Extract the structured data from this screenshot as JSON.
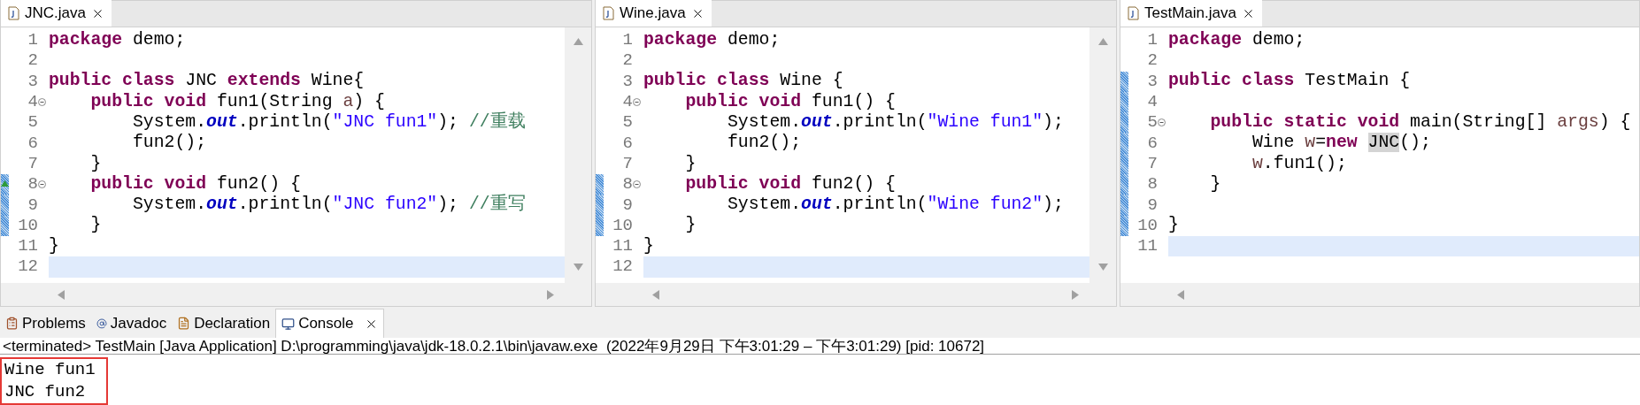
{
  "editors": [
    {
      "tab": {
        "title": "JNC.java",
        "selected": true
      },
      "vertical_scrollbar": true,
      "lines": [
        {
          "number": "1",
          "fold": false,
          "override": false,
          "changed": false,
          "current": false,
          "tokens": [
            {
              "kind": "kw",
              "text": "package"
            },
            {
              "kind": "text",
              "text": " demo;"
            }
          ]
        },
        {
          "number": "2",
          "fold": false,
          "override": false,
          "changed": false,
          "current": false
        },
        {
          "number": "3",
          "fold": false,
          "override": false,
          "changed": false,
          "current": false,
          "tokens": [
            {
              "kind": "kw",
              "text": "public class"
            },
            {
              "kind": "text",
              "text": " JNC "
            },
            {
              "kind": "kw",
              "text": "extends"
            },
            {
              "kind": "text",
              "text": " Wine{"
            }
          ]
        },
        {
          "number": "4",
          "fold": true,
          "override": false,
          "changed": false,
          "current": false,
          "tokens": [
            {
              "kind": "kw",
              "text": "    public void"
            },
            {
              "kind": "text",
              "text": " fun1(String "
            },
            {
              "kind": "var",
              "text": "a"
            },
            {
              "kind": "text",
              "text": ") {"
            }
          ]
        },
        {
          "number": "5",
          "fold": false,
          "override": false,
          "changed": false,
          "current": false,
          "tokens": [
            {
              "kind": "text",
              "text": "        System."
            },
            {
              "kind": "field",
              "text": "out"
            },
            {
              "kind": "text",
              "text": ".println("
            },
            {
              "kind": "str",
              "text": "\"JNC fun1\""
            },
            {
              "kind": "text",
              "text": "); "
            },
            {
              "kind": "comment",
              "text": "//重载"
            }
          ]
        },
        {
          "number": "6",
          "fold": false,
          "override": false,
          "changed": false,
          "current": false,
          "tokens": [
            {
              "kind": "text",
              "text": "        fun2();"
            }
          ]
        },
        {
          "number": "7",
          "fold": false,
          "override": false,
          "changed": false,
          "current": false,
          "tokens": [
            {
              "kind": "text",
              "text": "    }"
            }
          ]
        },
        {
          "number": "8",
          "fold": true,
          "override": true,
          "changed": true,
          "current": false,
          "tokens": [
            {
              "kind": "kw",
              "text": "    public void"
            },
            {
              "kind": "text",
              "text": " fun2() {"
            }
          ]
        },
        {
          "number": "9",
          "fold": false,
          "override": false,
          "changed": true,
          "current": false,
          "tokens": [
            {
              "kind": "text",
              "text": "        System."
            },
            {
              "kind": "field",
              "text": "out"
            },
            {
              "kind": "text",
              "text": ".println("
            },
            {
              "kind": "str",
              "text": "\"JNC fun2\""
            },
            {
              "kind": "text",
              "text": "); "
            },
            {
              "kind": "comment",
              "text": "//重写"
            }
          ]
        },
        {
          "number": "10",
          "fold": false,
          "override": false,
          "changed": true,
          "current": false,
          "tokens": [
            {
              "kind": "text",
              "text": "    }"
            }
          ]
        },
        {
          "number": "11",
          "fold": false,
          "override": false,
          "changed": false,
          "current": false,
          "tokens": [
            {
              "kind": "text",
              "text": "}"
            }
          ]
        },
        {
          "number": "12",
          "fold": false,
          "override": false,
          "changed": false,
          "current": true
        }
      ]
    },
    {
      "tab": {
        "title": "Wine.java",
        "selected": true
      },
      "vertical_scrollbar": true,
      "lines": [
        {
          "number": "1",
          "fold": false,
          "override": false,
          "changed": false,
          "current": false,
          "tokens": [
            {
              "kind": "kw",
              "text": "package"
            },
            {
              "kind": "text",
              "text": " demo;"
            }
          ]
        },
        {
          "number": "2",
          "fold": false,
          "override": false,
          "changed": false,
          "current": false
        },
        {
          "number": "3",
          "fold": false,
          "override": false,
          "changed": false,
          "current": false,
          "tokens": [
            {
              "kind": "kw",
              "text": "public class"
            },
            {
              "kind": "text",
              "text": " Wine {"
            }
          ]
        },
        {
          "number": "4",
          "fold": true,
          "override": false,
          "changed": false,
          "current": false,
          "tokens": [
            {
              "kind": "kw",
              "text": "    public void"
            },
            {
              "kind": "text",
              "text": " fun1() {"
            }
          ]
        },
        {
          "number": "5",
          "fold": false,
          "override": false,
          "changed": false,
          "current": false,
          "tokens": [
            {
              "kind": "text",
              "text": "        System."
            },
            {
              "kind": "field",
              "text": "out"
            },
            {
              "kind": "text",
              "text": ".println("
            },
            {
              "kind": "str",
              "text": "\"Wine fun1\""
            },
            {
              "kind": "text",
              "text": ");"
            }
          ]
        },
        {
          "number": "6",
          "fold": false,
          "override": false,
          "changed": false,
          "current": false,
          "tokens": [
            {
              "kind": "text",
              "text": "        fun2();"
            }
          ]
        },
        {
          "number": "7",
          "fold": false,
          "override": false,
          "changed": false,
          "current": false,
          "tokens": [
            {
              "kind": "text",
              "text": "    }"
            }
          ]
        },
        {
          "number": "8",
          "fold": true,
          "override": false,
          "changed": true,
          "current": false,
          "tokens": [
            {
              "kind": "kw",
              "text": "    public void"
            },
            {
              "kind": "text",
              "text": " fun2() {"
            }
          ]
        },
        {
          "number": "9",
          "fold": false,
          "override": false,
          "changed": true,
          "current": false,
          "tokens": [
            {
              "kind": "text",
              "text": "        System."
            },
            {
              "kind": "field",
              "text": "out"
            },
            {
              "kind": "text",
              "text": ".println("
            },
            {
              "kind": "str",
              "text": "\"Wine fun2\""
            },
            {
              "kind": "text",
              "text": ");"
            }
          ]
        },
        {
          "number": "10",
          "fold": false,
          "override": false,
          "changed": true,
          "current": false,
          "tokens": [
            {
              "kind": "text",
              "text": "    }"
            }
          ]
        },
        {
          "number": "11",
          "fold": false,
          "override": false,
          "changed": false,
          "current": false,
          "tokens": [
            {
              "kind": "text",
              "text": "}"
            }
          ]
        },
        {
          "number": "12",
          "fold": false,
          "override": false,
          "changed": false,
          "current": true
        }
      ]
    },
    {
      "tab": {
        "title": "TestMain.java",
        "selected": true
      },
      "vertical_scrollbar": false,
      "lines": [
        {
          "number": "1",
          "fold": false,
          "override": false,
          "changed": false,
          "current": false,
          "tokens": [
            {
              "kind": "kw",
              "text": "package"
            },
            {
              "kind": "text",
              "text": " demo;"
            }
          ]
        },
        {
          "number": "2",
          "fold": false,
          "override": false,
          "changed": false,
          "current": false
        },
        {
          "number": "3",
          "fold": false,
          "override": false,
          "changed": true,
          "current": false,
          "tokens": [
            {
              "kind": "kw",
              "text": "public class"
            },
            {
              "kind": "text",
              "text": " TestMain {"
            }
          ]
        },
        {
          "number": "4",
          "fold": false,
          "override": false,
          "changed": true,
          "current": false
        },
        {
          "number": "5",
          "fold": true,
          "override": false,
          "changed": true,
          "current": false,
          "tokens": [
            {
              "kind": "kw",
              "text": "    public static void"
            },
            {
              "kind": "text",
              "text": " main(String[] "
            },
            {
              "kind": "var",
              "text": "args"
            },
            {
              "kind": "text",
              "text": ") {"
            }
          ]
        },
        {
          "number": "6",
          "fold": false,
          "override": false,
          "changed": true,
          "current": false,
          "tokens": [
            {
              "kind": "text",
              "text": "        Wine "
            },
            {
              "kind": "var",
              "text": "w"
            },
            {
              "kind": "text",
              "text": "="
            },
            {
              "kind": "kw",
              "text": "new "
            },
            {
              "kind": "occurrence",
              "text": "JNC"
            },
            {
              "kind": "text",
              "text": "();"
            }
          ]
        },
        {
          "number": "7",
          "fold": false,
          "override": false,
          "changed": true,
          "current": false,
          "tokens": [
            {
              "kind": "var",
              "text": "        w"
            },
            {
              "kind": "text",
              "text": ".fun1();"
            }
          ]
        },
        {
          "number": "8",
          "fold": false,
          "override": false,
          "changed": true,
          "current": false,
          "tokens": [
            {
              "kind": "text",
              "text": "    }"
            }
          ]
        },
        {
          "number": "9",
          "fold": false,
          "override": false,
          "changed": true,
          "current": false
        },
        {
          "number": "10",
          "fold": false,
          "override": false,
          "changed": true,
          "current": false,
          "tokens": [
            {
              "kind": "text",
              "text": "}"
            }
          ]
        },
        {
          "number": "11",
          "fold": false,
          "override": false,
          "changed": false,
          "current": true
        }
      ]
    }
  ],
  "bottom_tabs": [
    {
      "label": "Problems",
      "kind": "problems",
      "selected": false,
      "closable": false
    },
    {
      "label": "Javadoc",
      "kind": "javadoc",
      "selected": false,
      "closable": false
    },
    {
      "label": "Declaration",
      "kind": "declaration",
      "selected": false,
      "closable": false
    },
    {
      "label": "Console",
      "kind": "console",
      "selected": true,
      "closable": true
    }
  ],
  "console": {
    "process": "<terminated> TestMain [Java Application] D:\\programming\\java\\jdk-18.0.2.1\\bin\\javaw.exe  (2022年9月29日 下午3:01:29 – 下午3:01:29) [pid: 10672]",
    "output_outlined": true,
    "output": [
      "Wine fun1",
      "JNC fun2"
    ]
  }
}
